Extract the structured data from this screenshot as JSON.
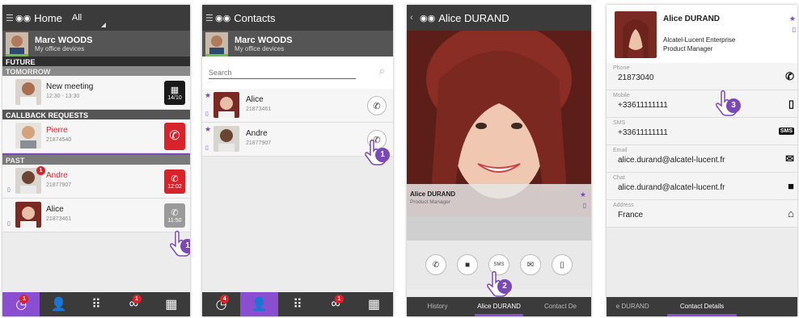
{
  "colors": {
    "accent": "#8a4fd0",
    "red": "#d9232a",
    "dark": "#3b3b3b",
    "green": "#6cc04a"
  },
  "screen1": {
    "title": "Home",
    "filter": "All",
    "user": {
      "name": "Marc WOODS",
      "sub": "My office devices"
    },
    "sections": {
      "future": "FUTURE",
      "tomorrow": "TOMORROW",
      "callback": "CALLBACK REQUESTS",
      "past": "PAST"
    },
    "meeting": {
      "title": "New meeting",
      "time": "12:30 - 13:30",
      "date": "14/10"
    },
    "callback": {
      "name": "Pierre",
      "number": "21874540"
    },
    "past": [
      {
        "name": "Andre",
        "number": "21877907",
        "time": "12:02",
        "badge": "1"
      },
      {
        "name": "Alice",
        "number": "21873461",
        "time": "11:50"
      }
    ],
    "nav_badges": {
      "history": "1",
      "voicemail": "1"
    }
  },
  "screen2": {
    "title": "Contacts",
    "user": {
      "name": "Marc WOODS",
      "sub": "My office devices"
    },
    "search_placeholder": "Search",
    "contacts": [
      {
        "name": "Alice",
        "number": "21873461"
      },
      {
        "name": "Andre",
        "number": "21877907"
      }
    ],
    "nav_badges": {
      "history": "4",
      "voicemail": "1"
    }
  },
  "screen3": {
    "title": "Alice DURAND",
    "name": "Alice DURAND",
    "role": "Product Manager",
    "tabs": [
      "History",
      "Alice DURAND",
      "Contact De"
    ]
  },
  "screen4": {
    "name": "Alice DURAND",
    "company": "Alcatel-Lucent Enterprise",
    "role": "Product Manager",
    "fields": [
      {
        "label": "Phone",
        "value": "21873040"
      },
      {
        "label": "Mobile",
        "value": "+33611111111"
      },
      {
        "label": "SMS",
        "value": "+33611111111"
      },
      {
        "label": "Email",
        "value": "alice.durand@alcatel-lucent.fr"
      },
      {
        "label": "Chat",
        "value": "alice.durand@alcatel-lucent.fr"
      },
      {
        "label": "Address",
        "value": "France"
      }
    ],
    "tabs": [
      "e DURAND",
      "Contact Details"
    ]
  },
  "steps": [
    "1",
    "1",
    "2",
    "3"
  ],
  "icons": [
    "menu-icon",
    "ale-logo-icon",
    "calendar-icon",
    "phone-icon",
    "search-icon",
    "star-icon",
    "mobile-icon",
    "chat-icon",
    "sms-icon",
    "email-icon",
    "home-icon",
    "history-icon",
    "person-icon",
    "dialpad-icon",
    "voicemail-icon",
    "keypad-icon",
    "hand-pointer-icon"
  ]
}
